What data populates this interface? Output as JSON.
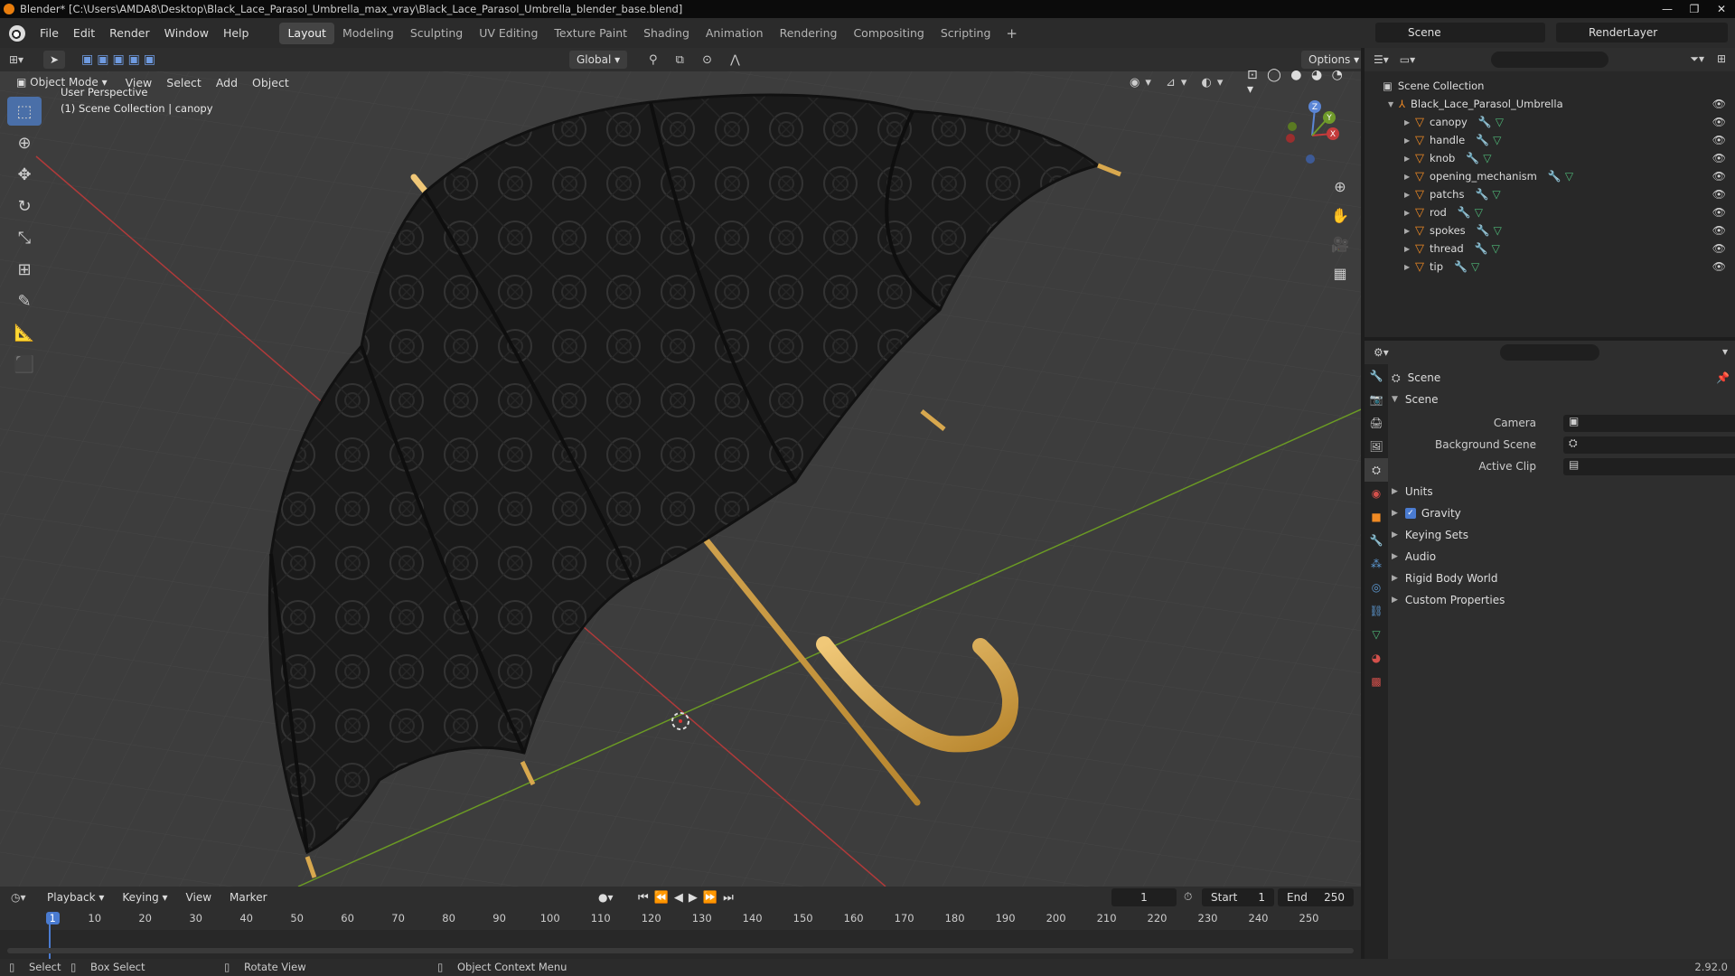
{
  "window": {
    "title": "Blender* [C:\\Users\\AMDA8\\Desktop\\Black_Lace_Parasol_Umbrella_max_vray\\Black_Lace_Parasol_Umbrella_blender_base.blend]",
    "minimize": "—",
    "maximize": "❐",
    "close": "✕"
  },
  "menu": [
    "File",
    "Edit",
    "Render",
    "Window",
    "Help"
  ],
  "workspaces": [
    "Layout",
    "Modeling",
    "Sculpting",
    "UV Editing",
    "Texture Paint",
    "Shading",
    "Animation",
    "Rendering",
    "Compositing",
    "Scripting"
  ],
  "active_workspace": "Layout",
  "scene": "Scene",
  "render_layer": "RenderLayer",
  "viewport": {
    "mode": "Object Mode",
    "menu": [
      "View",
      "Select",
      "Add",
      "Object"
    ],
    "orientation": "Global",
    "options": "Options",
    "perspective": "User Perspective",
    "collection_info": "(1) Scene Collection | canopy",
    "gizmo": {
      "x": "X",
      "y": "Y",
      "z": "Z"
    }
  },
  "outliner": {
    "root": "Scene Collection",
    "collection": "Black_Lace_Parasol_Umbrella",
    "objects": [
      "canopy",
      "handle",
      "knob",
      "opening_mechanism",
      "patchs",
      "rod",
      "spokes",
      "thread",
      "tip"
    ]
  },
  "properties": {
    "context": "Scene",
    "panel": "Scene",
    "fields": {
      "camera": "Camera",
      "background_scene": "Background Scene",
      "active_clip": "Active Clip"
    },
    "sections": [
      "Units",
      "Gravity",
      "Keying Sets",
      "Audio",
      "Rigid Body World",
      "Custom Properties"
    ],
    "gravity_checked": true
  },
  "timeline": {
    "menu": [
      "Playback",
      "Keying",
      "View",
      "Marker"
    ],
    "current_frame": "1",
    "start_label": "Start",
    "start": "1",
    "end_label": "End",
    "end": "250",
    "ticks": [
      "1",
      "10",
      "20",
      "30",
      "40",
      "50",
      "60",
      "70",
      "80",
      "90",
      "100",
      "110",
      "120",
      "130",
      "140",
      "150",
      "160",
      "170",
      "180",
      "190",
      "200",
      "210",
      "220",
      "230",
      "240",
      "250"
    ]
  },
  "status": {
    "select": "Select",
    "box_select": "Box Select",
    "rotate": "Rotate View",
    "context": "Object Context Menu",
    "version": "2.92.0"
  },
  "colors": {
    "accent": "#4a6fa8",
    "mesh": "#f08a24",
    "x_axis": "#c43b3b",
    "y_axis": "#6f9a2a"
  }
}
